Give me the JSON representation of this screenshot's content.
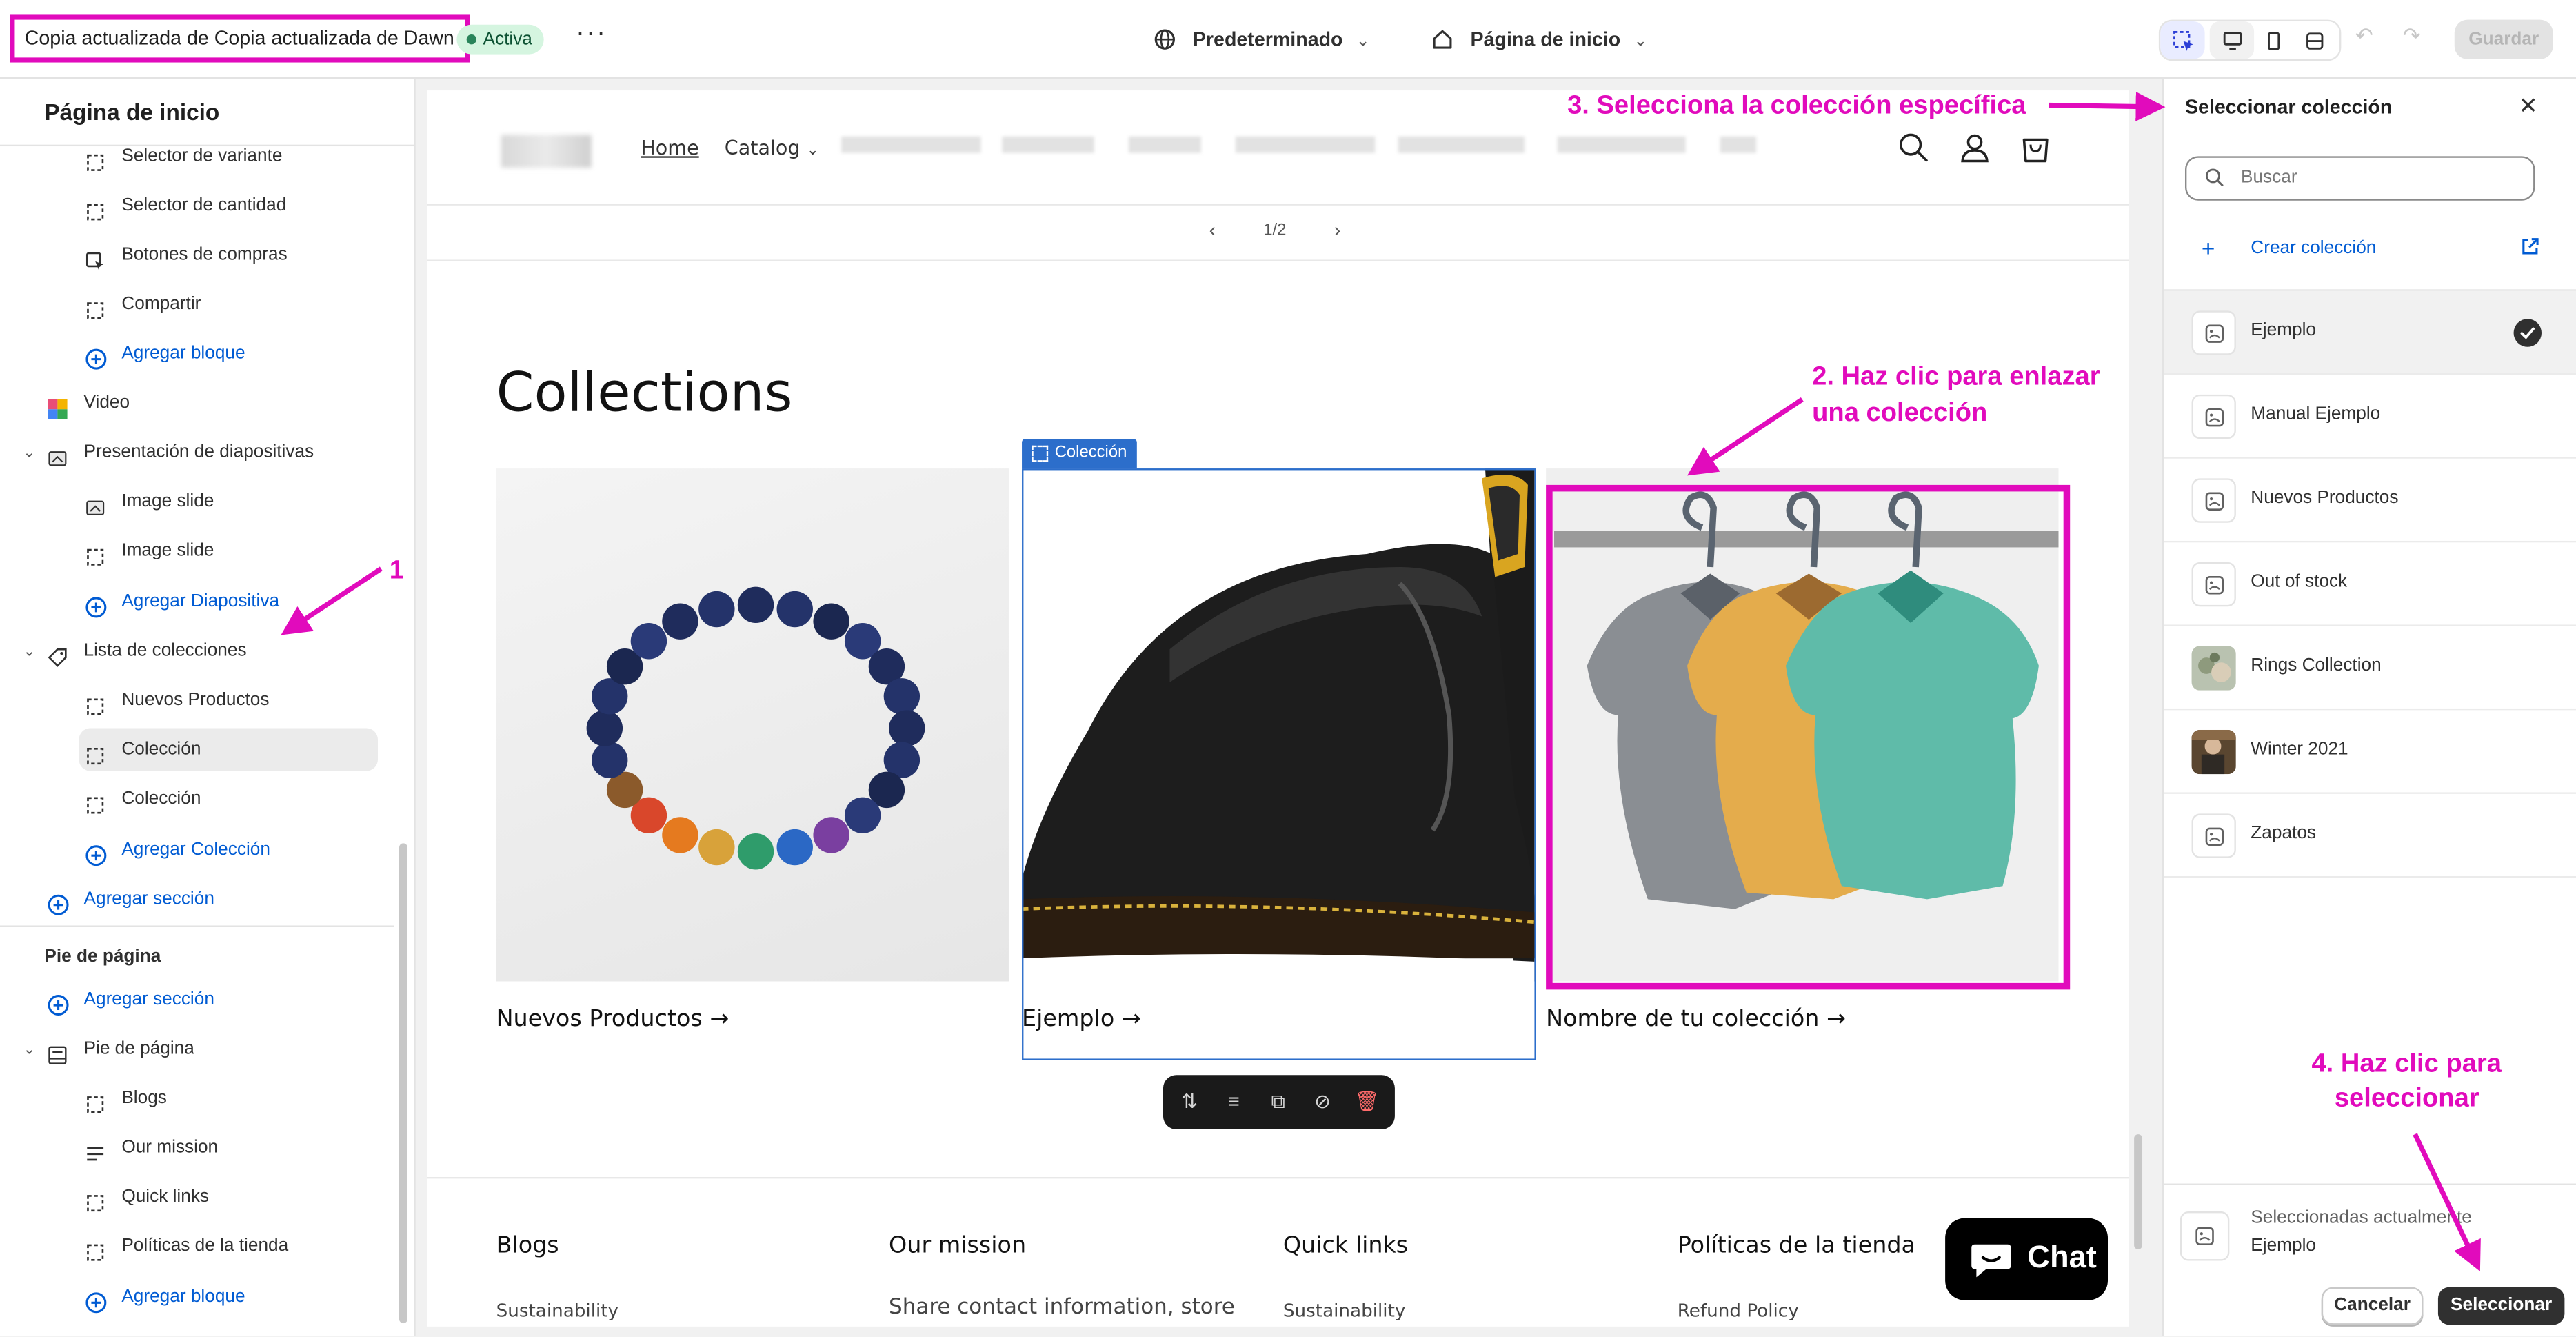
{
  "topbar": {
    "theme_title": "Copia actualizada de Copia actualizada de Dawn",
    "status": "Activa",
    "more": "···",
    "locale": "Predeterminado",
    "template": "Página de inicio",
    "save": "Guardar"
  },
  "sidebar": {
    "title": "Página de inicio",
    "items": [
      {
        "label": "Selector de variante",
        "icon": "dashed-square-icon"
      },
      {
        "label": "Selector de cantidad",
        "icon": "dashed-square-icon"
      },
      {
        "label": "Botones de compras",
        "icon": "cursor-square-icon"
      },
      {
        "label": "Compartir",
        "icon": "dashed-square-icon"
      },
      {
        "label": "Agregar bloque",
        "icon": "plus-circle-icon"
      },
      {
        "label": "Video",
        "icon": "video-icon"
      },
      {
        "label": "Presentación de diapositivas",
        "icon": "slideshow-icon"
      },
      {
        "label": "Image slide",
        "icon": "image-slide-icon"
      },
      {
        "label": "Image slide",
        "icon": "dashed-square-icon"
      },
      {
        "label": "Agregar Diapositiva",
        "icon": "plus-circle-icon"
      },
      {
        "label": "Lista de colecciones",
        "icon": "tag-icon"
      },
      {
        "label": "Nuevos Productos",
        "icon": "dashed-square-icon"
      },
      {
        "label": "Colección",
        "icon": "dashed-square-icon"
      },
      {
        "label": "Colección",
        "icon": "dashed-square-icon"
      },
      {
        "label": "Agregar Colección",
        "icon": "plus-circle-icon"
      },
      {
        "label": "Agregar sección",
        "icon": "plus-circle-icon"
      }
    ],
    "footer_section": "Pie de página",
    "footer_items": [
      {
        "label": "Agregar sección",
        "icon": "plus-circle-icon"
      },
      {
        "label": "Pie de página",
        "icon": "footer-icon"
      },
      {
        "label": "Blogs",
        "icon": "dashed-square-icon"
      },
      {
        "label": "Our mission",
        "icon": "text-lines-icon"
      },
      {
        "label": "Quick links",
        "icon": "dashed-square-icon"
      },
      {
        "label": "Políticas de la tienda",
        "icon": "dashed-square-icon"
      },
      {
        "label": "Agregar bloque",
        "icon": "plus-circle-icon"
      }
    ]
  },
  "preview": {
    "nav": {
      "home": "Home",
      "catalog": "Catalog"
    },
    "pager": {
      "count": "1/2"
    },
    "heading": "Collections",
    "selected_tag": "Colección",
    "cards": [
      {
        "caption": "Nuevos Productos →"
      },
      {
        "caption": "Ejemplo →"
      },
      {
        "caption": "Nombre de tu colección →"
      }
    ],
    "footer": {
      "cols": [
        {
          "head": "Blogs",
          "link": "Sustainability"
        },
        {
          "head": "Our mission",
          "link": "Share contact information, store"
        },
        {
          "head": "Quick links",
          "link": "Sustainability"
        },
        {
          "head": "Políticas de la tienda",
          "link": "Refund Policy"
        }
      ]
    },
    "chat": "Chat"
  },
  "right_panel": {
    "title": "Seleccionar colección",
    "search_placeholder": "Buscar",
    "create": "Crear colección",
    "collections": [
      {
        "name": "Ejemplo",
        "selected": true
      },
      {
        "name": "Manual Ejemplo",
        "selected": false
      },
      {
        "name": "Nuevos Productos",
        "selected": false
      },
      {
        "name": "Out of stock",
        "selected": false
      },
      {
        "name": "Rings Collection",
        "selected": false
      },
      {
        "name": "Winter 2021",
        "selected": false
      },
      {
        "name": "Zapatos",
        "selected": false
      }
    ],
    "current_label": "Seleccionadas actualmente",
    "current_value": "Ejemplo",
    "cancel": "Cancelar",
    "select": "Seleccionar"
  },
  "annotations": {
    "a1": "1",
    "a2_line1": "2. Haz clic para enlazar",
    "a2_line2": "una colección",
    "a3": "3. Selecciona la colección específica",
    "a4_line1": "4. Haz clic para",
    "a4_line2": "seleccionar"
  },
  "colors": {
    "annotation": "#e10bbc",
    "accent": "#005bd3",
    "selection": "#2c6ecb"
  }
}
